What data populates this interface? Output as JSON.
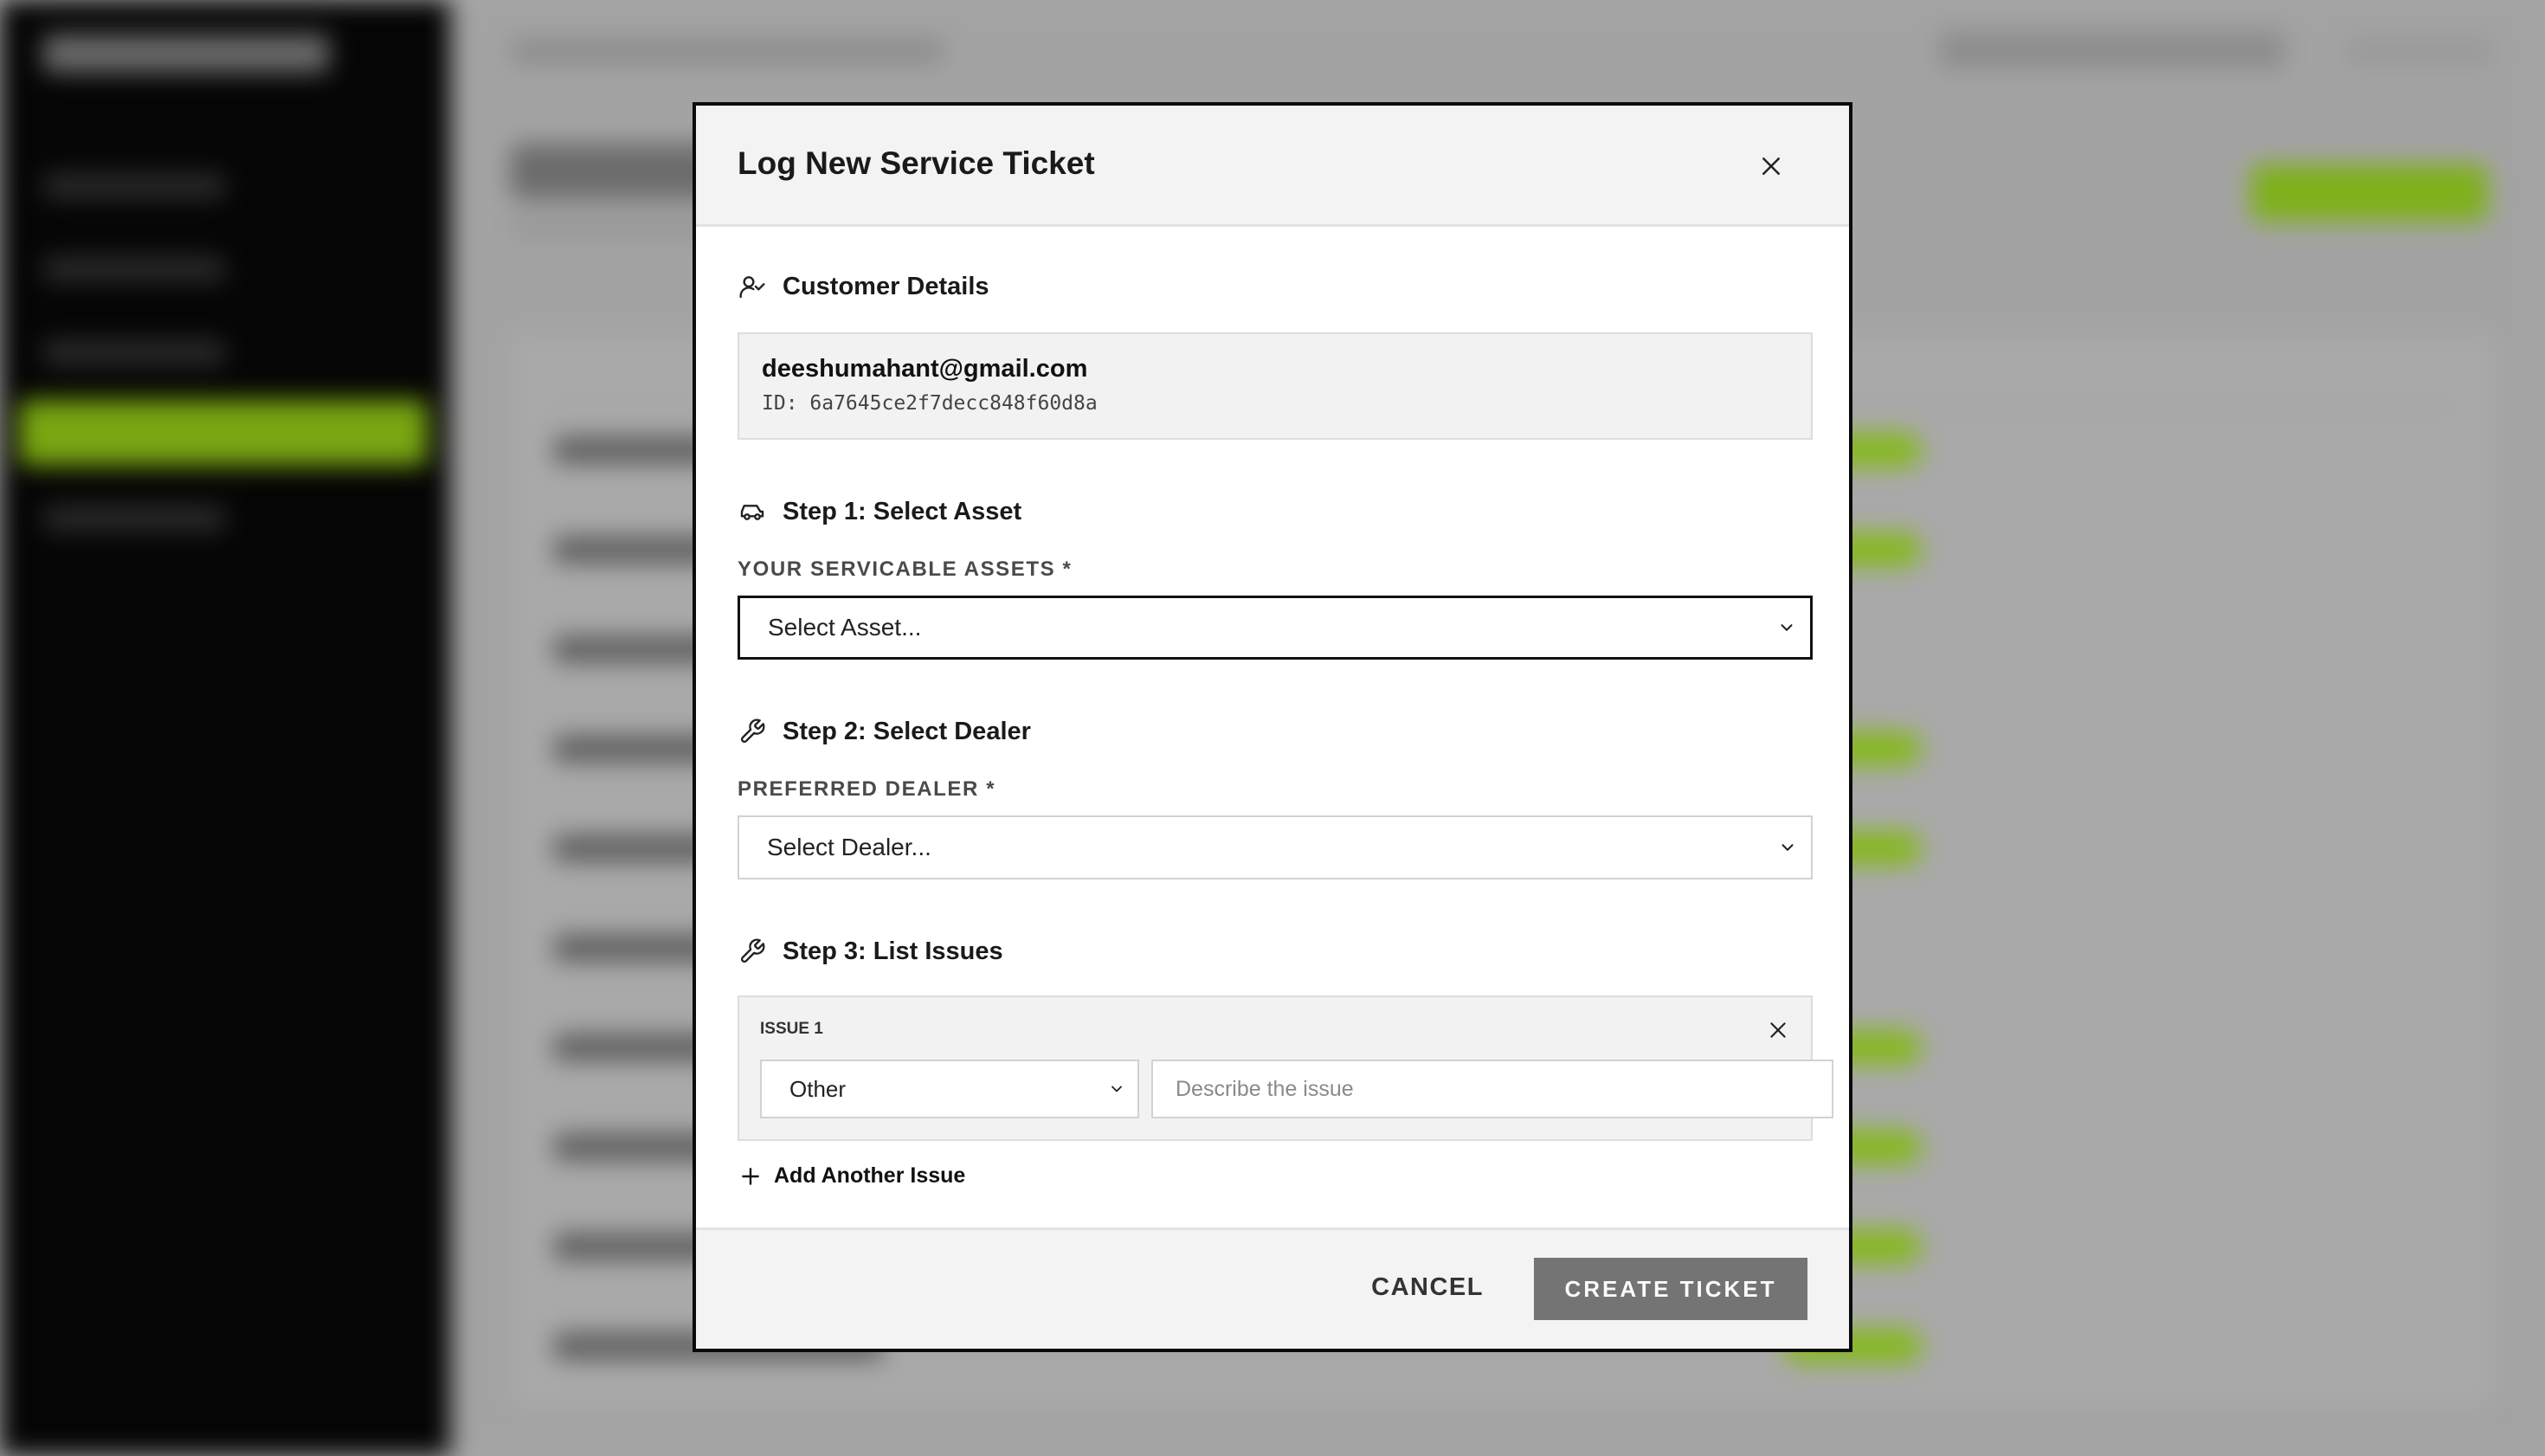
{
  "modal": {
    "title": "Log New Service Ticket",
    "close_icon": "close-icon"
  },
  "customer": {
    "section_title": "Customer Details",
    "section_icon": "user-check-icon",
    "email": "deeshumahant@gmail.com",
    "id": "ID: 6a7645ce2f7decc848f60d8a"
  },
  "step1": {
    "section_title": "Step 1: Select Asset",
    "section_icon": "car-icon",
    "label": "YOUR SERVICABLE ASSETS *",
    "selected": "Select Asset..."
  },
  "step2": {
    "section_title": "Step 2: Select Dealer",
    "section_icon": "wrench-icon",
    "label": "PREFERRED DEALER *",
    "selected": "Select Dealer..."
  },
  "step3": {
    "section_title": "Step 3: List Issues",
    "section_icon": "wrench-icon",
    "issues": [
      {
        "label": "ISSUE 1",
        "type_selected": "Other",
        "description_value": "",
        "description_placeholder": "Describe the issue"
      }
    ],
    "add_label": "Add Another Issue"
  },
  "footer": {
    "cancel_label": "CANCEL",
    "create_label": "CREATE TICKET"
  },
  "colors": {
    "accent_green": "#86b81e",
    "modal_border": "#0a0a0a",
    "primary_button": "#747474"
  }
}
